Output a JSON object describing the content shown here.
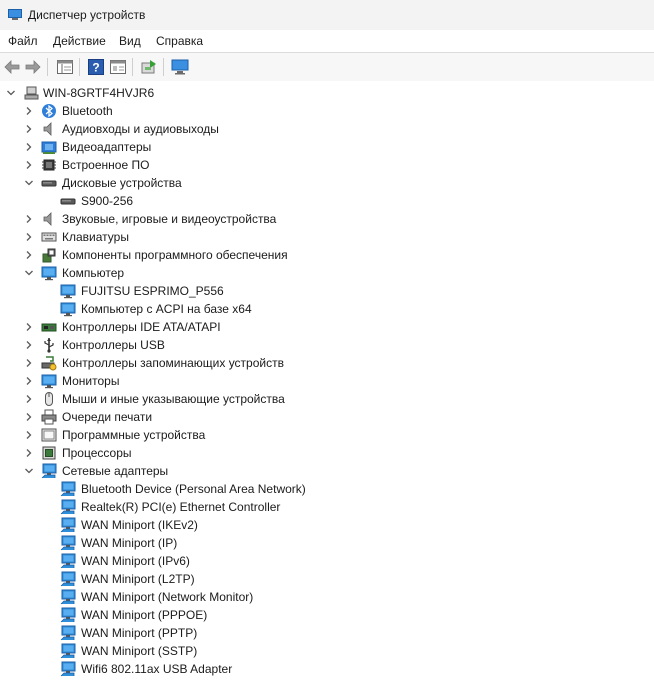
{
  "window": {
    "title": "Диспетчер устройств"
  },
  "menu": {
    "file": "Файл",
    "action": "Действие",
    "view": "Вид",
    "help": "Справка"
  },
  "tree": {
    "root": "WIN-8GRTF4HVJR6",
    "nodes": [
      {
        "label": "Bluetooth",
        "icon": "bluetooth-icon",
        "expanded": false
      },
      {
        "label": "Аудиовходы и аудиовыходы",
        "icon": "speaker-icon",
        "expanded": false
      },
      {
        "label": "Видеоадаптеры",
        "icon": "display-adapter-icon",
        "expanded": false
      },
      {
        "label": "Встроенное ПО",
        "icon": "firmware-icon",
        "expanded": false
      },
      {
        "label": "Дисковые устройства",
        "icon": "disk-drive-icon",
        "expanded": true
      },
      {
        "label": "S900-256",
        "icon": "disk-drive-icon",
        "child": true
      },
      {
        "label": "Звуковые, игровые и видеоустройства",
        "icon": "speaker-icon",
        "expanded": false
      },
      {
        "label": "Клавиатуры",
        "icon": "keyboard-icon",
        "expanded": false
      },
      {
        "label": "Компоненты программного обеспечения",
        "icon": "software-component-icon",
        "expanded": false
      },
      {
        "label": "Компьютер",
        "icon": "monitor-icon",
        "expanded": true
      },
      {
        "label": "FUJITSU ESPRIMO_P556",
        "icon": "monitor-icon",
        "child": true
      },
      {
        "label": "Компьютер с ACPI на базе x64",
        "icon": "monitor-icon",
        "child": true
      },
      {
        "label": "Контроллеры IDE ATA/ATAPI",
        "icon": "ide-controller-icon",
        "expanded": false
      },
      {
        "label": "Контроллеры USB",
        "icon": "usb-icon",
        "expanded": false
      },
      {
        "label": "Контроллеры запоминающих устройств",
        "icon": "storage-controller-icon",
        "expanded": false
      },
      {
        "label": "Мониторы",
        "icon": "monitor-icon",
        "expanded": false
      },
      {
        "label": "Мыши и иные указывающие устройства",
        "icon": "mouse-icon",
        "expanded": false
      },
      {
        "label": "Очереди печати",
        "icon": "printer-icon",
        "expanded": false
      },
      {
        "label": "Программные устройства",
        "icon": "software-device-icon",
        "expanded": false
      },
      {
        "label": "Процессоры",
        "icon": "processor-icon",
        "expanded": false
      },
      {
        "label": "Сетевые адаптеры",
        "icon": "network-adapter-icon",
        "expanded": true
      },
      {
        "label": "Bluetooth Device (Personal Area Network)",
        "icon": "network-adapter-icon",
        "child": true
      },
      {
        "label": "Realtek(R) PCI(e) Ethernet Controller",
        "icon": "network-adapter-icon",
        "child": true
      },
      {
        "label": "WAN Miniport (IKEv2)",
        "icon": "network-adapter-icon",
        "child": true
      },
      {
        "label": "WAN Miniport (IP)",
        "icon": "network-adapter-icon",
        "child": true
      },
      {
        "label": "WAN Miniport (IPv6)",
        "icon": "network-adapter-icon",
        "child": true
      },
      {
        "label": "WAN Miniport (L2TP)",
        "icon": "network-adapter-icon",
        "child": true
      },
      {
        "label": "WAN Miniport (Network Monitor)",
        "icon": "network-adapter-icon",
        "child": true
      },
      {
        "label": "WAN Miniport (PPPOE)",
        "icon": "network-adapter-icon",
        "child": true
      },
      {
        "label": "WAN Miniport (PPTP)",
        "icon": "network-adapter-icon",
        "child": true
      },
      {
        "label": "WAN Miniport (SSTP)",
        "icon": "network-adapter-icon",
        "child": true
      },
      {
        "label": "Wifi6 802.11ax USB Adapter",
        "icon": "network-adapter-icon",
        "child": true
      }
    ]
  },
  "colors": {
    "accent": "#2f7fd8",
    "text": "#1b1b1b",
    "chevron": "#5a5a5a"
  }
}
